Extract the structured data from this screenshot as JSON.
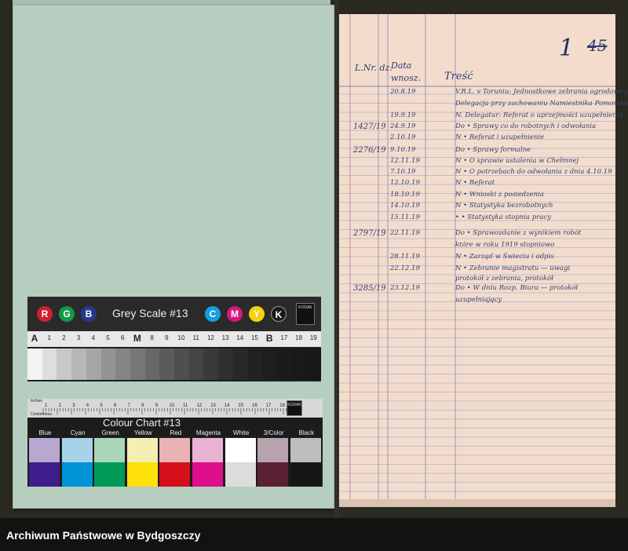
{
  "document": {
    "folio_number": "1",
    "folio_number_struck": "45",
    "columns": [
      {
        "label": "L.Nr. dz."
      },
      {
        "label": "Data wnosz."
      },
      {
        "label": "Treść"
      }
    ],
    "entries": [
      {
        "num": "",
        "date": "20.8.19",
        "text": "V.R.L. v Toruniu: Jednostkowe zebrania ogrodowe jako"
      },
      {
        "num": "",
        "date": "",
        "text": "Delegacja przy zachowaniu Namiestnika Pomorskiego"
      },
      {
        "num": "",
        "date": "19.9.19",
        "text": "N. Delegatur: Referat o uprzejmości uzupełnienia"
      },
      {
        "num": "1427/19",
        "date": "24.9.19",
        "text": "Do  • Sprawy co do robotnych i odwołania"
      },
      {
        "num": "",
        "date": "2.10.19",
        "text": "N  • Referat i uzupełnienie"
      },
      {
        "num": "2276/19",
        "date": "9.10.19",
        "text": "Do  • Sprawy formalne"
      },
      {
        "num": "",
        "date": "12.11.19",
        "text": "N  • O sprawie ustalenia w Chełmnej"
      },
      {
        "num": "",
        "date": "7.10.19",
        "text": "N  • O potrzebach do odwołania z dnia 4.10.19"
      },
      {
        "num": "",
        "date": "12.10.19",
        "text": "N  • Referat"
      },
      {
        "num": "",
        "date": "18.10.19",
        "text": "N  • Wnioski z posiedzenia"
      },
      {
        "num": "",
        "date": "14.10.19",
        "text": "N  • Statystyka bezrobotnych"
      },
      {
        "num": "",
        "date": "15.11.19",
        "text": "•  • Statystyka stopnia pracy"
      },
      {
        "num": "2797/19",
        "date": "22.11.19",
        "text": "Do  • Sprawozdanie z wynikiem robót"
      },
      {
        "num": "",
        "date": "",
        "text": "które w roku 1919 stopniowo"
      },
      {
        "num": "",
        "date": "28.11.19",
        "text": "N  • Zarząd w Świeciu i odpis"
      },
      {
        "num": "",
        "date": "22.12.19",
        "text": "N  • Zebranie magistratu — uwagi"
      },
      {
        "num": "",
        "date": "",
        "text": "protokół z zebrania, protokół"
      },
      {
        "num": "3285/19",
        "date": "23.12.19",
        "text": "Do  • W dniu Rozp. Biura — protokół"
      },
      {
        "num": "",
        "date": "",
        "text": "uzupełniający"
      }
    ]
  },
  "grey_scale": {
    "title": "Grey Scale #13",
    "rgb": [
      "R",
      "G",
      "B"
    ],
    "cmyk": [
      "C",
      "M",
      "Y",
      "K"
    ],
    "logo": "KODAK",
    "scale_labels": [
      "A",
      "1",
      "2",
      "3",
      "4",
      "5",
      "6",
      "M",
      "8",
      "9",
      "10",
      "11",
      "12",
      "13",
      "14",
      "15",
      "B",
      "17",
      "18",
      "19"
    ],
    "patches": [
      "#f4f4f4",
      "#dedede",
      "#c8c8c8",
      "#b7b7b7",
      "#a5a5a5",
      "#949494",
      "#858585",
      "#767676",
      "#686868",
      "#5b5b5b",
      "#4f4f4f",
      "#444444",
      "#3a3a3a",
      "#303030",
      "#282828",
      "#222222",
      "#1e1e1e",
      "#1b1b1b",
      "#191919",
      "#171717"
    ]
  },
  "colour_chart": {
    "title": "Colour Chart #13",
    "ruler_inches": "Inches",
    "ruler_cm": "Centimetres",
    "ruler_numbers": [
      "1",
      "2",
      "3",
      "4",
      "5",
      "6",
      "7",
      "8",
      "9",
      "10",
      "11",
      "12",
      "13",
      "14",
      "15",
      "16",
      "17",
      "18",
      "19"
    ],
    "logo": "KODAK",
    "labels": [
      "Blue",
      "Cyan",
      "Green",
      "Yellow",
      "Red",
      "Magenta",
      "White",
      "3/Color",
      "Black"
    ],
    "top_colors": [
      "#b8a7d0",
      "#a7d3e8",
      "#a9d6b7",
      "#f2efb0",
      "#e9b2b4",
      "#ebb3d3",
      "#ffffff",
      "#b7a2ad",
      "#bdbdbd"
    ],
    "bottom_colors": [
      "#3e1e8a",
      "#0093d6",
      "#009a58",
      "#fee10a",
      "#d40f1c",
      "#df0e8c",
      "#dcdcdc",
      "#5b2132",
      "#161616"
    ]
  },
  "footer": {
    "text": "Archiwum Państwowe w Bydgoszczy"
  }
}
